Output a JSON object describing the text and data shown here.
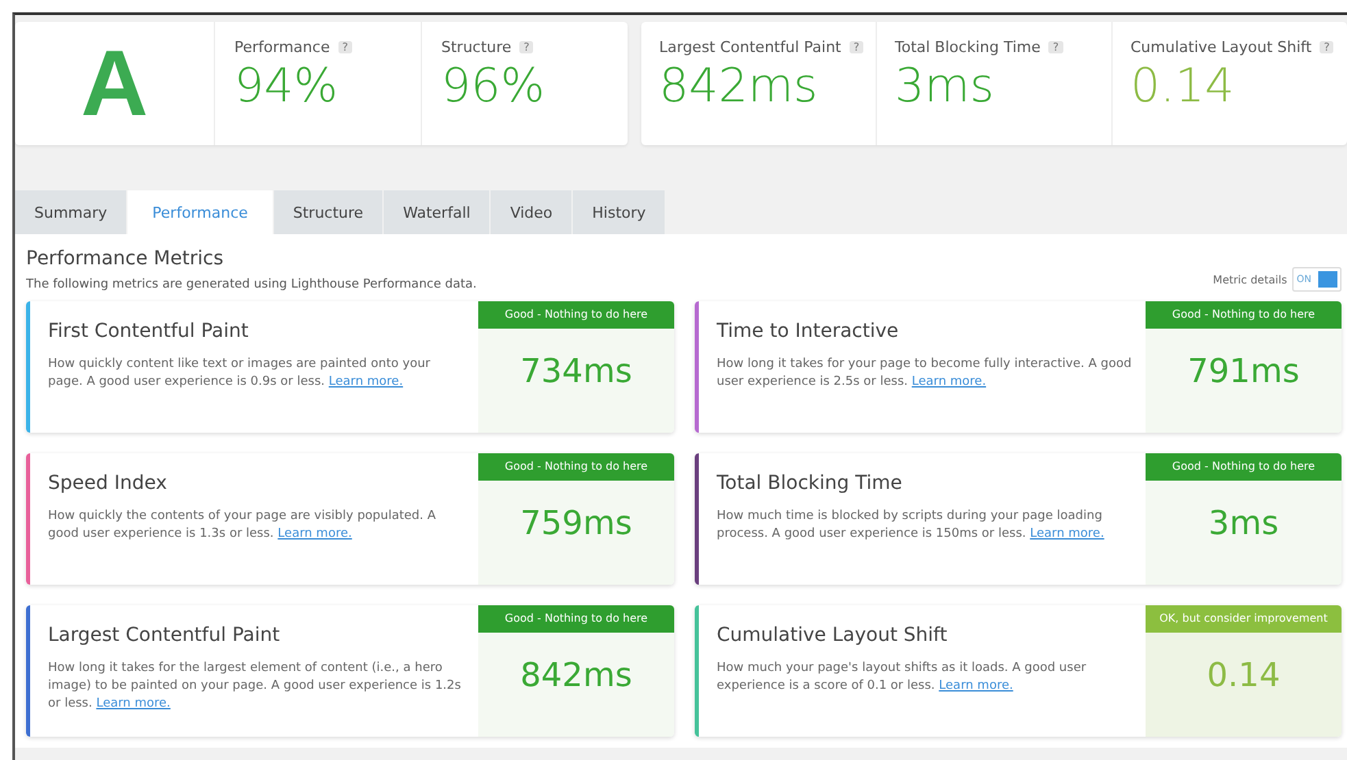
{
  "grade": "A",
  "scores": [
    {
      "label": "Performance",
      "help": "?",
      "value": "94%",
      "kind": "good"
    },
    {
      "label": "Structure",
      "help": "?",
      "value": "96%",
      "kind": "good"
    }
  ],
  "vitals": [
    {
      "label": "Largest Contentful Paint",
      "help": "?",
      "value": "842ms",
      "kind": "good"
    },
    {
      "label": "Total Blocking Time",
      "help": "?",
      "value": "3ms",
      "kind": "good"
    },
    {
      "label": "Cumulative Layout Shift",
      "help": "?",
      "value": "0.14",
      "kind": "ok"
    }
  ],
  "tabs": [
    {
      "label": "Summary",
      "selected": false
    },
    {
      "label": "Performance",
      "selected": true
    },
    {
      "label": "Structure",
      "selected": false
    },
    {
      "label": "Waterfall",
      "selected": false
    },
    {
      "label": "Video",
      "selected": false
    },
    {
      "label": "History",
      "selected": false
    }
  ],
  "section": {
    "title": "Performance Metrics",
    "subtitle": "The following metrics are generated using Lighthouse Performance data."
  },
  "metric_details": {
    "label": "Metric details",
    "state_text": "ON",
    "on": true
  },
  "metrics": [
    {
      "title": "First Contentful Paint",
      "description": "How quickly content like text or images are painted onto your page. A good user experience is 0.9s or less.",
      "link": "Learn more.",
      "badge": "Good - Nothing to do here",
      "value": "734ms",
      "kind": "good",
      "color": "#3bb3e8"
    },
    {
      "title": "Time to Interactive",
      "description": "How long it takes for your page to become fully interactive. A good user experience is 2.5s or less.",
      "link": "Learn more.",
      "badge": "Good - Nothing to do here",
      "value": "791ms",
      "kind": "good",
      "color": "#b66ad0"
    },
    {
      "title": "Speed Index",
      "description": "How quickly the contents of your page are visibly populated. A good user experience is 1.3s or less.",
      "link": "Learn more.",
      "badge": "Good - Nothing to do here",
      "value": "759ms",
      "kind": "good",
      "color": "#e8609a"
    },
    {
      "title": "Total Blocking Time",
      "description": "How much time is blocked by scripts during your page loading process. A good user experience is 150ms or less.",
      "link": "Learn more.",
      "badge": "Good - Nothing to do here",
      "value": "3ms",
      "kind": "good",
      "color": "#6a3f7e"
    },
    {
      "title": "Largest Contentful Paint",
      "description": "How long it takes for the largest element of content (i.e., a hero image) to be painted on your page. A good user experience is 1.2s or less.",
      "link": "Learn more.",
      "badge": "Good - Nothing to do here",
      "value": "842ms",
      "kind": "good",
      "color": "#3e6fd1"
    },
    {
      "title": "Cumulative Layout Shift",
      "description": "How much your page's layout shifts as it loads. A good user experience is a score of 0.1 or less.",
      "link": "Learn more.",
      "badge": "OK, but consider improvement",
      "value": "0.14",
      "kind": "ok",
      "color": "#45c29a"
    }
  ]
}
